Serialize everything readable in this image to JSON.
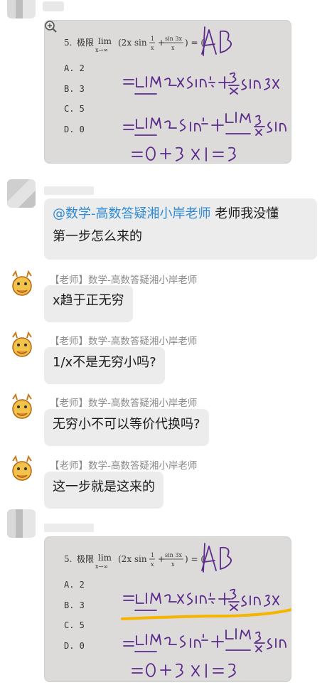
{
  "messages": [
    {
      "type": "image",
      "sender_hidden": true
    },
    {
      "type": "text",
      "sender_hidden": true,
      "mention": "@数学-高数答疑湘小岸老师",
      "text_line1": " 老师我没懂",
      "text_line2": "第一步怎么来的"
    },
    {
      "type": "text",
      "sender": "【老师】数学-高数答疑湘小岸老师",
      "text": "x趋于正无穷"
    },
    {
      "type": "text",
      "sender": "【老师】数学-高数答疑湘小岸老师",
      "text": "1/x不是无穷小吗?"
    },
    {
      "type": "text",
      "sender": "【老师】数学-高数答疑湘小岸老师",
      "text": "无穷小不可以等价代换吗?"
    },
    {
      "type": "text",
      "sender": "【老师】数学-高数答疑湘小岸老师",
      "text": "这一步就是这来的"
    },
    {
      "type": "image",
      "sender_hidden": true,
      "highlight_color": "#f5b400"
    }
  ],
  "problem": {
    "number": "5.",
    "stem": "极限",
    "lim": "lim",
    "lim_sub": "x→∞",
    "expr_open": "(2x sin",
    "frac1_num": "1",
    "frac1_den": "x",
    "plus": "+",
    "frac2_num": "sin 3x",
    "frac2_den": "x",
    "expr_close": ") = (",
    "options": [
      "A. 2",
      "B. 3",
      "C. 5",
      "D. 0"
    ],
    "handwritten_answer": "AB",
    "handwritten_result": "=0+3×1=3"
  },
  "icons": {
    "zoom": "zoom-in-icon",
    "teacher_avatar": "dragon-avatar-icon"
  }
}
